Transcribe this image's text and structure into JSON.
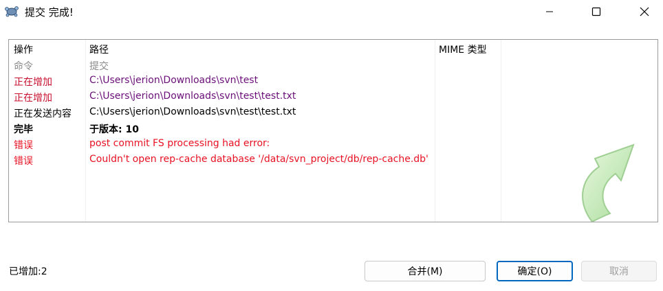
{
  "window": {
    "title": "提交 完成!",
    "icon": "tortoise-svn-icon"
  },
  "list": {
    "headers": {
      "action": "操作",
      "path": "路径",
      "mime": "MIME 类型"
    },
    "rows": [
      {
        "action": "命令",
        "path": "提交",
        "style": "gray"
      },
      {
        "action": "正在增加",
        "path": "C:\\Users\\jerion\\Downloads\\svn\\test",
        "style": "added"
      },
      {
        "action": "正在增加",
        "path": "C:\\Users\\jerion\\Downloads\\svn\\test\\test.txt",
        "style": "added"
      },
      {
        "action": "正在发送内容",
        "path": "C:\\Users\\jerion\\Downloads\\svn\\test\\test.txt",
        "style": "normal"
      },
      {
        "action": "完毕",
        "path": "于版本: 10",
        "style": "bold"
      },
      {
        "action": "错误",
        "path": "post commit FS processing had error:",
        "style": "error"
      },
      {
        "action": "错误",
        "path": "Couldn't open rep-cache database '/data/svn_project/db/rep-cache.db'",
        "style": "error"
      }
    ]
  },
  "footer": {
    "status": "已增加:2",
    "merge_label": "合并(M)",
    "ok_label": "确定(O)",
    "cancel_label": "取消"
  },
  "colors": {
    "added_action": "#c8102e",
    "added_path": "#6a0f78",
    "error": "#e81123",
    "accent": "#0067c0"
  }
}
